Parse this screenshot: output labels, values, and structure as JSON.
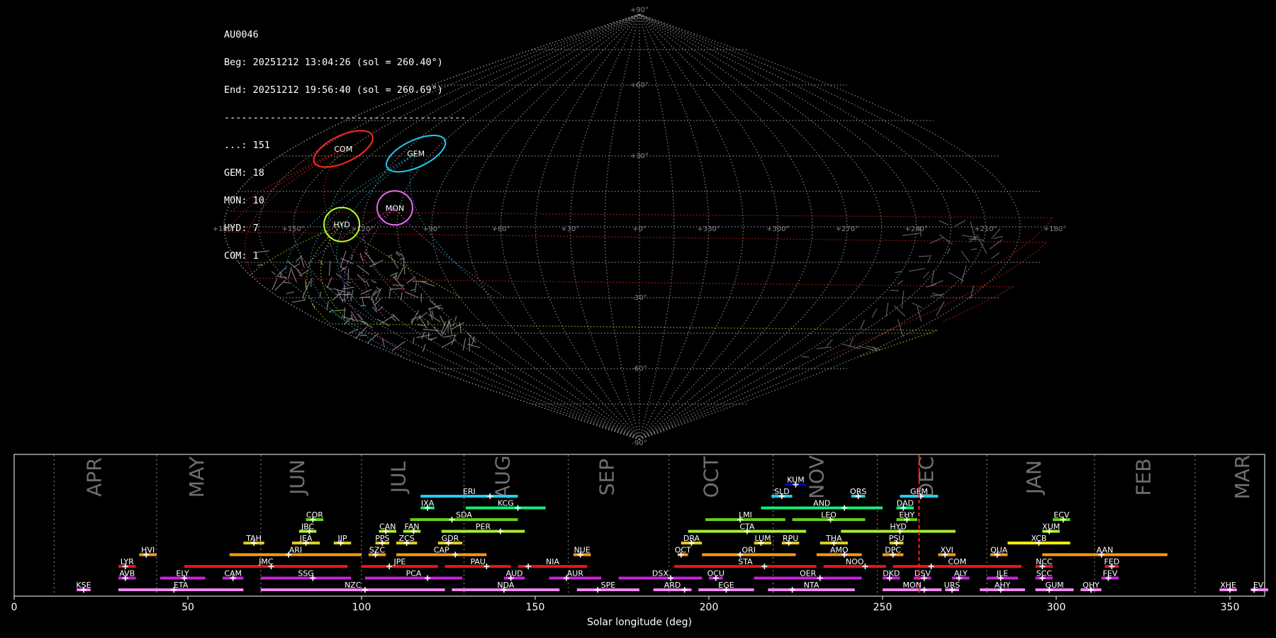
{
  "stats": {
    "station": "AU0046",
    "begin": "Beg: 20251212 13:04:26 (sol = 260.40°)",
    "end": "End: 20251212 19:56:40 (sol = 260.69°)",
    "separator": "------------------------------------------",
    "counts": [
      "...: 151",
      "GEM: 18",
      "MON: 10",
      "HYD: 7",
      "COM: 1"
    ]
  },
  "sky_map": {
    "projection": "sinusoidal",
    "lon_tick_labels": [
      "+180°",
      "+150°",
      "+120°",
      "+90°",
      "+60°",
      "+30°",
      "+0°",
      "+330°",
      "+300°",
      "+270°",
      "+240°",
      "+210°",
      "+180°"
    ],
    "lat_tick_labels": [
      "+90°",
      "+60°",
      "+30°",
      "-30°",
      "-60°",
      "-90°"
    ],
    "showers": [
      {
        "code": "COM",
        "color": "#ff2a1a",
        "lon": 153,
        "lat": 33
      },
      {
        "code": "GEM",
        "color": "#22ccee",
        "lon": 113,
        "lat": 31
      },
      {
        "code": "MON",
        "color": "#ee66ee",
        "lon": 107,
        "lat": 8
      },
      {
        "code": "HYD",
        "color": "#bbff22",
        "lon": 129,
        "lat": 1
      }
    ],
    "colors": {
      "grid": "#888888",
      "sporadic": "#999999"
    }
  },
  "chart_data": {
    "type": "timeline",
    "xlabel": "Solar longitude (deg)",
    "xlim": [
      0,
      365
    ],
    "xticks": [
      0,
      50,
      100,
      150,
      200,
      250,
      300,
      350
    ],
    "current_sol": 260.5,
    "month_boundaries": [
      11.5,
      41,
      71,
      100,
      129.5,
      159.5,
      188.5,
      218.5,
      248.5,
      280,
      311,
      340
    ],
    "months": [
      {
        "label": "APR",
        "x": 25
      },
      {
        "label": "MAY",
        "x": 54.5
      },
      {
        "label": "JUN",
        "x": 83.5
      },
      {
        "label": "JUL",
        "x": 112.5
      },
      {
        "label": "AUG",
        "x": 142.5
      },
      {
        "label": "SEP",
        "x": 172.5
      },
      {
        "label": "OCT",
        "x": 202.5
      },
      {
        "label": "NOV",
        "x": 233
      },
      {
        "label": "DEC",
        "x": 264.5
      },
      {
        "label": "JAN",
        "x": 295.5
      },
      {
        "label": "FEB",
        "x": 327
      },
      {
        "label": "MAR",
        "x": 355.5
      }
    ],
    "showers": [
      {
        "code": "KUM",
        "start": 222,
        "end": 228,
        "peak": 225,
        "row": 10,
        "color": "#0000cc"
      },
      {
        "code": "ERI",
        "start": 117,
        "end": 145,
        "peak": 137,
        "row": 9,
        "color": "#22ccee"
      },
      {
        "code": "SLD",
        "start": 218,
        "end": 224,
        "peak": 221,
        "row": 9,
        "color": "#22ccee"
      },
      {
        "code": "ORS",
        "start": 241,
        "end": 245,
        "peak": 243,
        "row": 9,
        "color": "#22ccee"
      },
      {
        "code": "GEM",
        "start": 255,
        "end": 266,
        "peak": 261,
        "row": 9,
        "color": "#22ccee"
      },
      {
        "code": "IXA",
        "start": 117,
        "end": 121,
        "peak": 119,
        "row": 8,
        "color": "#11ee77"
      },
      {
        "code": "KCG",
        "start": 130,
        "end": 153,
        "peak": 145,
        "row": 8,
        "color": "#11ee77"
      },
      {
        "code": "AND",
        "start": 215,
        "end": 250,
        "peak": 239,
        "row": 8,
        "color": "#11ee77"
      },
      {
        "code": "DAD",
        "start": 254,
        "end": 259,
        "peak": 256,
        "row": 8,
        "color": "#11ee77"
      },
      {
        "code": "COR",
        "start": 84,
        "end": 89,
        "peak": 86,
        "row": 7,
        "color": "#66cc22"
      },
      {
        "code": "SDA",
        "start": 114,
        "end": 145,
        "peak": 126,
        "row": 7,
        "color": "#66cc22"
      },
      {
        "code": "LMI",
        "start": 199,
        "end": 222,
        "peak": 209,
        "row": 7,
        "color": "#66cc22"
      },
      {
        "code": "LEO",
        "start": 224,
        "end": 245,
        "peak": 235,
        "row": 7,
        "color": "#66cc22"
      },
      {
        "code": "EHY",
        "start": 254,
        "end": 260,
        "peak": 257,
        "row": 7,
        "color": "#66cc22"
      },
      {
        "code": "ECV",
        "start": 299,
        "end": 304,
        "peak": 302,
        "row": 7,
        "color": "#66cc22"
      },
      {
        "code": "JBC",
        "start": 82,
        "end": 87,
        "peak": 85,
        "row": 6,
        "color": "#aaee33"
      },
      {
        "code": "CAN",
        "start": 105,
        "end": 110,
        "peak": 107,
        "row": 6,
        "color": "#aaee33"
      },
      {
        "code": "FAN",
        "start": 112,
        "end": 117,
        "peak": 115,
        "row": 6,
        "color": "#aaee33"
      },
      {
        "code": "PER",
        "start": 123,
        "end": 147,
        "peak": 140,
        "row": 6,
        "color": "#aaee33"
      },
      {
        "code": "CTA",
        "start": 194,
        "end": 228,
        "peak": 211,
        "row": 6,
        "color": "#aaee33"
      },
      {
        "code": "HYD",
        "start": 238,
        "end": 271,
        "peak": 255,
        "row": 6,
        "color": "#aaee33"
      },
      {
        "code": "XUM",
        "start": 296,
        "end": 301,
        "peak": 298,
        "row": 6,
        "color": "#aaee33"
      },
      {
        "code": "TAH",
        "start": 66,
        "end": 72,
        "peak": 69,
        "row": 5,
        "color": "#ddcc22"
      },
      {
        "code": "JEA",
        "start": 80,
        "end": 88,
        "peak": 84,
        "row": 5,
        "color": "#ddcc22"
      },
      {
        "code": "JIP",
        "start": 92,
        "end": 97,
        "peak": 94,
        "row": 5,
        "color": "#ddcc22"
      },
      {
        "code": "PPS",
        "start": 104,
        "end": 108,
        "peak": 106,
        "row": 5,
        "color": "#ddcc22"
      },
      {
        "code": "ZCS",
        "start": 110,
        "end": 116,
        "peak": 113,
        "row": 5,
        "color": "#ddcc22"
      },
      {
        "code": "GDR",
        "start": 122,
        "end": 129,
        "peak": 125,
        "row": 5,
        "color": "#ddcc22"
      },
      {
        "code": "DRA",
        "start": 192,
        "end": 198,
        "peak": 195,
        "row": 5,
        "color": "#ddcc22"
      },
      {
        "code": "LUM",
        "start": 213,
        "end": 218,
        "peak": 215,
        "row": 5,
        "color": "#ddcc22"
      },
      {
        "code": "RPU",
        "start": 221,
        "end": 226,
        "peak": 223,
        "row": 5,
        "color": "#ddcc22"
      },
      {
        "code": "THA",
        "start": 232,
        "end": 240,
        "peak": 236,
        "row": 5,
        "color": "#ddcc22"
      },
      {
        "code": "PSU",
        "start": 252,
        "end": 256,
        "peak": 254,
        "row": 5,
        "color": "#ddcc22"
      },
      {
        "code": "XCB",
        "start": 286,
        "end": 304,
        "peak": 295,
        "row": 5,
        "color": "#ffee00"
      },
      {
        "code": "HVI",
        "start": 36,
        "end": 41,
        "peak": 38,
        "row": 4,
        "color": "#ff9911"
      },
      {
        "code": "ARI",
        "start": 62,
        "end": 100,
        "peak": 79,
        "row": 4,
        "color": "#ff9911"
      },
      {
        "code": "SZC",
        "start": 102,
        "end": 107,
        "peak": 104,
        "row": 4,
        "color": "#ff9911"
      },
      {
        "code": "CAP",
        "start": 110,
        "end": 136,
        "peak": 127,
        "row": 4,
        "color": "#ff9911"
      },
      {
        "code": "NUE",
        "start": 161,
        "end": 166,
        "peak": 163,
        "row": 4,
        "color": "#ff9911"
      },
      {
        "code": "OCT",
        "start": 191,
        "end": 194,
        "peak": 192,
        "row": 4,
        "color": "#ff9911"
      },
      {
        "code": "ORI",
        "start": 198,
        "end": 225,
        "peak": 209,
        "row": 4,
        "color": "#ff9911"
      },
      {
        "code": "AMO",
        "start": 231,
        "end": 244,
        "peak": 239,
        "row": 4,
        "color": "#ff9911"
      },
      {
        "code": "DPC",
        "start": 250,
        "end": 256,
        "peak": 253,
        "row": 4,
        "color": "#ff9911"
      },
      {
        "code": "XVI",
        "start": 266,
        "end": 271,
        "peak": 268,
        "row": 4,
        "color": "#ff9911"
      },
      {
        "code": "QUA",
        "start": 281,
        "end": 286,
        "peak": 283,
        "row": 4,
        "color": "#ff9911"
      },
      {
        "code": "AAN",
        "start": 296,
        "end": 332,
        "peak": 313,
        "row": 4,
        "color": "#ff9911"
      },
      {
        "code": "LYR",
        "start": 30,
        "end": 35,
        "peak": 32,
        "row": 3,
        "color": "#ee1111"
      },
      {
        "code": "JMC",
        "start": 49,
        "end": 96,
        "peak": 74,
        "row": 3,
        "color": "#ee1111"
      },
      {
        "code": "JPE",
        "start": 100,
        "end": 122,
        "peak": 108,
        "row": 3,
        "color": "#ee1111"
      },
      {
        "code": "PAU",
        "start": 124,
        "end": 143,
        "peak": 136,
        "row": 3,
        "color": "#ee1111"
      },
      {
        "code": "NIA",
        "start": 145,
        "end": 165,
        "peak": 148,
        "row": 3,
        "color": "#ee1111"
      },
      {
        "code": "STA",
        "start": 190,
        "end": 231,
        "peak": 216,
        "row": 3,
        "color": "#ee1111"
      },
      {
        "code": "NOO",
        "start": 233,
        "end": 251,
        "peak": 245,
        "row": 3,
        "color": "#ee1111"
      },
      {
        "code": "COM",
        "start": 253,
        "end": 290,
        "peak": 264,
        "row": 3,
        "color": "#ee1111"
      },
      {
        "code": "NCC",
        "start": 294,
        "end": 299,
        "peak": 296,
        "row": 3,
        "color": "#ee1111"
      },
      {
        "code": "FED",
        "start": 314,
        "end": 318,
        "peak": 316,
        "row": 3,
        "color": "#ee1111"
      },
      {
        "code": "AVB",
        "start": 30,
        "end": 35,
        "peak": 32,
        "row": 2,
        "color": "#cc22dd"
      },
      {
        "code": "ELY",
        "start": 42,
        "end": 55,
        "peak": 49,
        "row": 2,
        "color": "#cc22dd"
      },
      {
        "code": "CAM",
        "start": 60,
        "end": 66,
        "peak": 63,
        "row": 2,
        "color": "#cc22dd"
      },
      {
        "code": "SSG",
        "start": 71,
        "end": 97,
        "peak": 86,
        "row": 2,
        "color": "#cc22dd"
      },
      {
        "code": "PCA",
        "start": 101,
        "end": 129,
        "peak": 119,
        "row": 2,
        "color": "#cc22dd"
      },
      {
        "code": "AUD",
        "start": 141,
        "end": 147,
        "peak": 143,
        "row": 2,
        "color": "#cc22dd"
      },
      {
        "code": "AUR",
        "start": 154,
        "end": 169,
        "peak": 159,
        "row": 2,
        "color": "#cc22dd"
      },
      {
        "code": "DSX",
        "start": 174,
        "end": 198,
        "peak": 189,
        "row": 2,
        "color": "#cc22dd"
      },
      {
        "code": "OCU",
        "start": 200,
        "end": 204,
        "peak": 202,
        "row": 2,
        "color": "#cc22dd"
      },
      {
        "code": "OER",
        "start": 213,
        "end": 244,
        "peak": 232,
        "row": 2,
        "color": "#cc22dd"
      },
      {
        "code": "DKD",
        "start": 250,
        "end": 255,
        "peak": 252,
        "row": 2,
        "color": "#cc22dd"
      },
      {
        "code": "DSV",
        "start": 259,
        "end": 264,
        "peak": 262,
        "row": 2,
        "color": "#cc22dd"
      },
      {
        "code": "ALY",
        "start": 270,
        "end": 275,
        "peak": 272,
        "row": 2,
        "color": "#cc22dd"
      },
      {
        "code": "JLE",
        "start": 280,
        "end": 289,
        "peak": 284,
        "row": 2,
        "color": "#cc22dd"
      },
      {
        "code": "SCC",
        "start": 294,
        "end": 299,
        "peak": 296,
        "row": 2,
        "color": "#cc22dd"
      },
      {
        "code": "FEV",
        "start": 313,
        "end": 318,
        "peak": 315,
        "row": 2,
        "color": "#cc22dd"
      },
      {
        "code": "KSE",
        "start": 18,
        "end": 22,
        "peak": 20,
        "row": 1,
        "color": "#ee88ee"
      },
      {
        "code": "ETA",
        "start": 30,
        "end": 66,
        "peak": 46,
        "row": 1,
        "color": "#ee88ee"
      },
      {
        "code": "NZC",
        "start": 71,
        "end": 124,
        "peak": 101,
        "row": 1,
        "color": "#ee88ee"
      },
      {
        "code": "NDA",
        "start": 126,
        "end": 157,
        "peak": 141,
        "row": 1,
        "color": "#ee88ee"
      },
      {
        "code": "SPE",
        "start": 162,
        "end": 180,
        "peak": 168,
        "row": 1,
        "color": "#ee88ee"
      },
      {
        "code": "ARD",
        "start": 184,
        "end": 195,
        "peak": 193,
        "row": 1,
        "color": "#ee88ee"
      },
      {
        "code": "EGE",
        "start": 197,
        "end": 213,
        "peak": 205,
        "row": 1,
        "color": "#ee88ee"
      },
      {
        "code": "NTA",
        "start": 217,
        "end": 242,
        "peak": 224,
        "row": 1,
        "color": "#ee88ee"
      },
      {
        "code": "MON",
        "start": 250,
        "end": 267,
        "peak": 262,
        "row": 1,
        "color": "#ee88ee"
      },
      {
        "code": "URS",
        "start": 268,
        "end": 272,
        "peak": 270,
        "row": 1,
        "color": "#ee88ee"
      },
      {
        "code": "AHY",
        "start": 278,
        "end": 291,
        "peak": 284,
        "row": 1,
        "color": "#ee88ee"
      },
      {
        "code": "GUM",
        "start": 294,
        "end": 305,
        "peak": 298,
        "row": 1,
        "color": "#ee88ee"
      },
      {
        "code": "QHY",
        "start": 307,
        "end": 313,
        "peak": 310,
        "row": 1,
        "color": "#ee88ee"
      },
      {
        "code": "XHE",
        "start": 347,
        "end": 352,
        "peak": 350,
        "row": 1,
        "color": "#ee88ee"
      },
      {
        "code": "EVI",
        "start": 356,
        "end": 361,
        "peak": 357,
        "row": 1,
        "color": "#ee88ee"
      }
    ]
  }
}
